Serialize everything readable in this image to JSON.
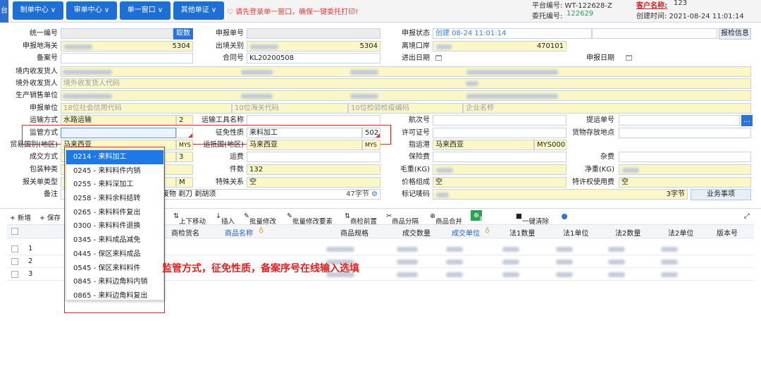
{
  "toolbar": {
    "logo": "台",
    "btn1": "制单中心 ∨",
    "btn2": "审单中心 ∨",
    "btn3": "单一窗口 ∨",
    "btn4": "其他单证 ∨",
    "warning": "请先登录单一窗口，确保一键委托打印!",
    "platform_label": "平台编号: WT-122628-Z",
    "entrust_label": "委托编号:",
    "entrust_value": "122629",
    "customer_label": "客户名称:",
    "customer_value": "123",
    "created": "创建时间: 2021-08-24 11:01:14"
  },
  "form": {
    "l_tongyi": "统一编号",
    "btn_quhao": "取数",
    "l_shenbaohao": "申报单号",
    "l_zhuangtai": "申报状态",
    "v_zhuangtai": "创建 08-24 11:01:14",
    "btn_baojian": "报检信息",
    "l_dihaiguan": "申报地海关",
    "v_dihaiguan_code": "5304",
    "l_chujingguanbie": "出境关别",
    "v_chujing_code": "5304",
    "l_likou": "离境口岸",
    "v_likou_code": "470101",
    "l_beian": "备案号",
    "l_hetong": "合同号",
    "v_hetong": "KL20200508",
    "l_chujinri": "进出日期",
    "l_shenbaori": "申报日期",
    "l_jingnei": "境内收发货人",
    "l_jingwai": "境外收发货人",
    "ph_jingwai": "境外收发货人代码",
    "l_shengchan": "生产销售单位",
    "l_shenbaodanwei": "申报单位",
    "ph_shxy": "18位社会信用代码",
    "ph_hg": "10位海关代码",
    "ph_jyjy": "10位检验检疫编码",
    "ph_qymc": "企业名称",
    "l_yunshu": "运输方式",
    "v_yunshu": "水路运输",
    "v_yunshu_code": "2",
    "l_gongju": "运输工具名称",
    "l_hangci": "航次号",
    "l_tiyun": "提运单号",
    "l_jianguan": "监管方式",
    "l_zhengmian": "征免性质",
    "v_zhengmian": "来料加工",
    "v_zhengmian_code": "502",
    "l_xuke": "许可证号",
    "l_cunfang": "货物存放地点",
    "l_maoyi": "贸易国别(地区)",
    "v_maoyi": "马来西亚",
    "v_maoyi_code": "MYS",
    "l_yundi": "运抵国(地区)",
    "v_yundi": "马来西亚",
    "v_yundi_code": "MYS",
    "l_zhiyun": "指运港",
    "v_zhiyun": "马来西亚",
    "v_zhiyun_code": "MYS000",
    "l_chengjiao": "成交方式",
    "v_chengjiao_code": "3",
    "l_yunfei": "运费",
    "l_baoxian": "保险费",
    "l_zafei": "杂费",
    "l_baozhuang": "包装种类",
    "l_jianshu": "件数",
    "v_jianshu": "132",
    "l_maozhong": "毛重(KG)",
    "l_jingzhong": "净重(KG)",
    "l_baoguan": "报关单类型",
    "v_baoguan_code": "M",
    "l_teshu": "特殊关系",
    "v_teshu": "空",
    "l_jiage": "价格组成",
    "v_jiage": "空",
    "l_texu": "特许权使用费",
    "v_texu": "空",
    "l_beizhu": "备注",
    "v_beizhu": "废物 剃刀 剃胡须",
    "v_bytes": "47字节",
    "l_biaoji": "标记唛码",
    "v_biaoji_bytes": "3字节",
    "btn_yewu": "业务事项"
  },
  "grid": {
    "tb_add": "+ 新增",
    "tb_save": "+ 保存",
    "tb_updown": "上下移动",
    "tb_insert": "插入",
    "tb_batch": "批量修改",
    "tb_batch2": "批量修改要素",
    "tb_before": "商检前置",
    "tb_split": "商品分隔",
    "tb_merge": "商品合并",
    "tb_query": "商品查询",
    "tb_clear": "一键清除",
    "h_gname": "商检货名",
    "h_pname": "商品名称",
    "h_spec": "商品规格",
    "h_qty": "成交数量",
    "h_unit": "成交单位",
    "h_q1": "法1数量",
    "h_u1": "法1单位",
    "h_q2": "法2数量",
    "h_u2": "法2单位",
    "h_ver": "版本号",
    "rows": [
      "1",
      "2",
      "3"
    ]
  },
  "dropdown": {
    "items": [
      "0214 - 来料加工",
      "0245 - 来料料件内销",
      "0255 - 来料深加工",
      "0258 - 来料余料结转",
      "0265 - 来料料件复出",
      "0300 - 来料料件退换",
      "0345 - 来料成品减免",
      "0445 - 保区来料成品",
      "0545 - 保区来料料件",
      "0845 - 来料边角料内销",
      "0865 - 来料边角料复出"
    ]
  },
  "annotation": "监管方式，征免性质，备案序号在线输入选填",
  "colors": {
    "accent": "#1d6fd6",
    "warning": "#e02222",
    "highlight": "#fbf7c7"
  }
}
